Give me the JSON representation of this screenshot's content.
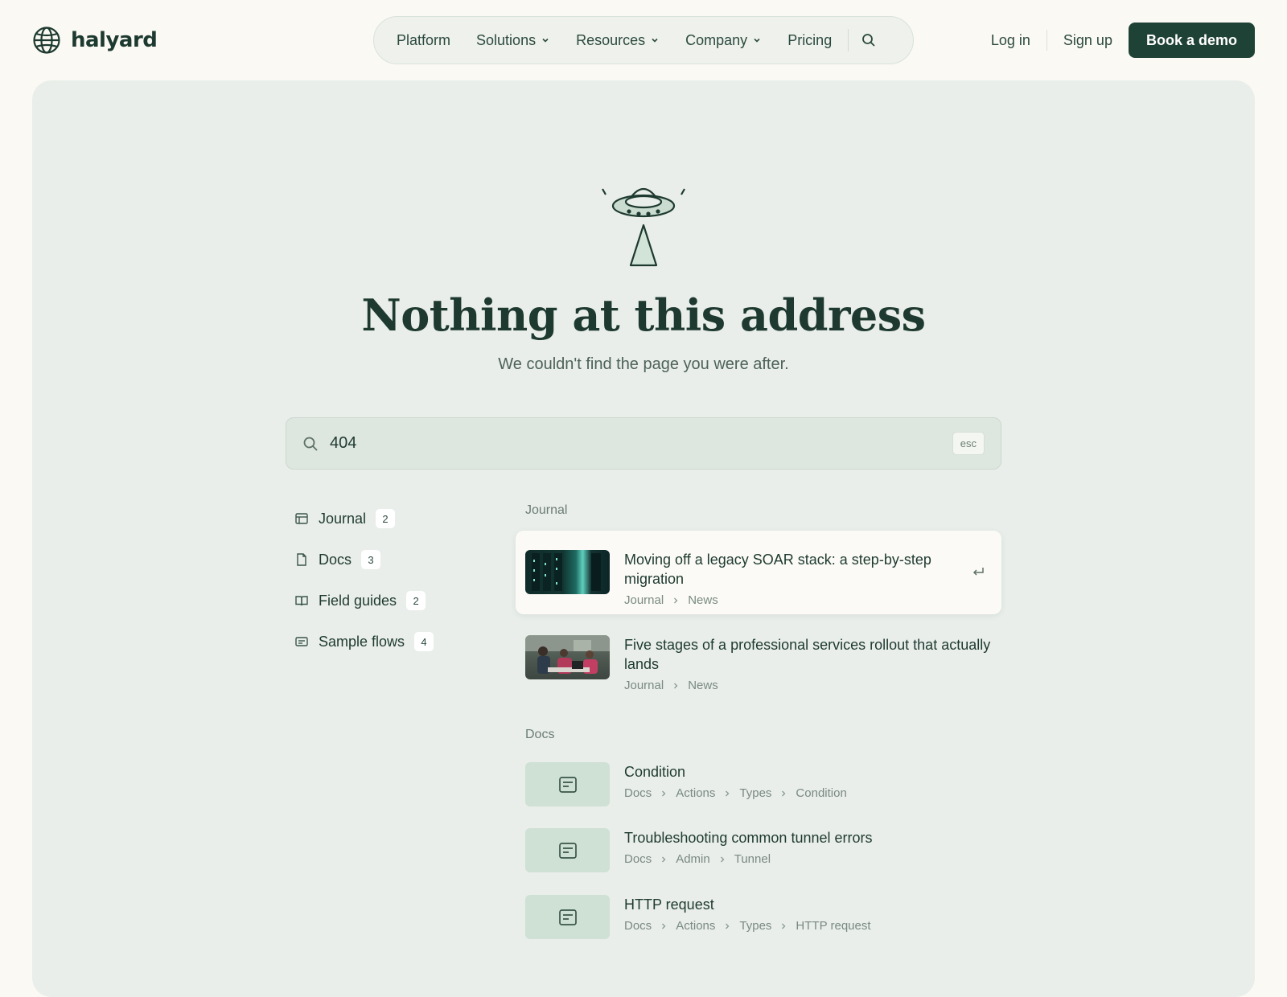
{
  "brand": {
    "name": "halyard"
  },
  "nav": {
    "items": [
      {
        "label": "Platform",
        "has_menu": false
      },
      {
        "label": "Solutions",
        "has_menu": true
      },
      {
        "label": "Resources",
        "has_menu": true
      },
      {
        "label": "Company",
        "has_menu": true
      },
      {
        "label": "Pricing",
        "has_menu": false
      }
    ]
  },
  "auth": {
    "login": "Log in",
    "signup": "Sign up",
    "demo": "Book a demo"
  },
  "hero": {
    "title": "Nothing at this address",
    "subtitle": "We couldn't find the page you were after."
  },
  "search": {
    "value": "404",
    "esc_hint": "esc"
  },
  "filters": [
    {
      "label": "Journal",
      "count": "2",
      "icon": "layout-icon"
    },
    {
      "label": "Docs",
      "count": "3",
      "icon": "file-icon"
    },
    {
      "label": "Field guides",
      "count": "2",
      "icon": "book-icon"
    },
    {
      "label": "Sample flows",
      "count": "4",
      "icon": "message-icon"
    }
  ],
  "results": {
    "journal_label": "Journal",
    "journal": [
      {
        "title": "Moving off a legacy SOAR stack: a step-by-step migration",
        "crumbs": [
          "Journal",
          "News"
        ]
      },
      {
        "title": "Five stages of a professional services rollout that actually lands",
        "crumbs": [
          "Journal",
          "News"
        ]
      }
    ],
    "docs_label": "Docs",
    "docs": [
      {
        "title": "Condition",
        "crumbs": [
          "Docs",
          "Actions",
          "Types",
          "Condition"
        ]
      },
      {
        "title": "Troubleshooting common tunnel errors",
        "crumbs": [
          "Docs",
          "Admin",
          "Tunnel"
        ]
      },
      {
        "title": "HTTP request",
        "crumbs": [
          "Docs",
          "Actions",
          "Types",
          "HTTP request"
        ]
      }
    ]
  },
  "colors": {
    "background": "#fbf9f4",
    "panel": "#e9eeea",
    "primary": "#1f4237",
    "accent_light": "#cfe0d4"
  }
}
